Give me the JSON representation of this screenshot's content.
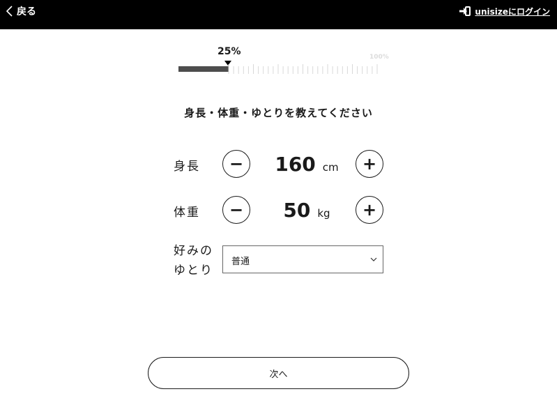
{
  "header": {
    "back_label": "戻る",
    "login_label": "unisizeにログイン"
  },
  "progress": {
    "value_percent": 25,
    "label": "25%",
    "max_label": "100%"
  },
  "question": "身長・体重・ゆとりを教えてください",
  "height": {
    "label": "身長",
    "value": "160",
    "unit": "cm",
    "minus": "−",
    "plus": "+"
  },
  "weight": {
    "label": "体重",
    "value": "50",
    "unit": "kg",
    "minus": "−",
    "plus": "+"
  },
  "fit": {
    "label_line1": "好みの",
    "label_line2": "ゆとり",
    "selected": "普通"
  },
  "next_label": "次へ",
  "icons": {
    "back": "chevron-left-icon",
    "login": "sign-in-icon",
    "select": "chevron-down-icon"
  }
}
